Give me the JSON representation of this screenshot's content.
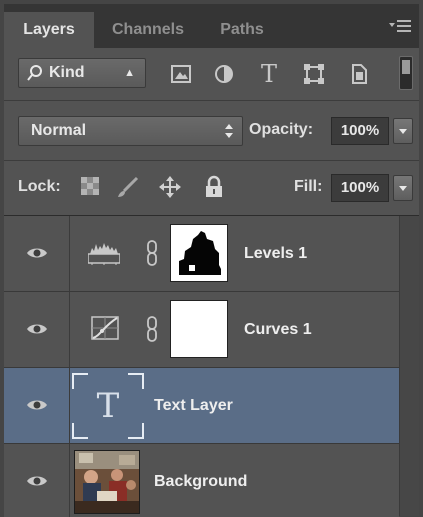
{
  "tabs": [
    {
      "label": "Layers",
      "active": true
    },
    {
      "label": "Channels",
      "active": false
    },
    {
      "label": "Paths",
      "active": false
    }
  ],
  "panel_menu_icon": "panel-menu-icon",
  "filter": {
    "kind_label": "Kind",
    "kind_icon": "search-icon",
    "icons": [
      "pixel-layer-filter-icon",
      "adjustment-layer-filter-icon",
      "type-layer-filter-icon",
      "shape-layer-filter-icon",
      "smart-object-filter-icon"
    ],
    "type_glyph": "T"
  },
  "blend": {
    "mode": "Normal",
    "opacity_label": "Opacity:",
    "opacity_value": "100%"
  },
  "lock": {
    "label": "Lock:",
    "icons": [
      "lock-transparent-pixels-icon",
      "lock-image-pixels-icon",
      "lock-position-icon",
      "lock-all-icon"
    ],
    "fill_label": "Fill:",
    "fill_value": "100%"
  },
  "layers": [
    {
      "name": "Levels 1",
      "type": "adjustment-levels",
      "visible": true,
      "selected": false
    },
    {
      "name": "Curves 1",
      "type": "adjustment-curves",
      "visible": true,
      "selected": false
    },
    {
      "name": "Text Layer",
      "type": "text",
      "glyph": "T",
      "visible": true,
      "selected": true
    },
    {
      "name": "Background",
      "type": "image",
      "visible": true,
      "selected": false
    }
  ],
  "colors": {
    "panel": "#535353",
    "tab_bar": "#353535",
    "selected_row": "#5a6d87"
  }
}
